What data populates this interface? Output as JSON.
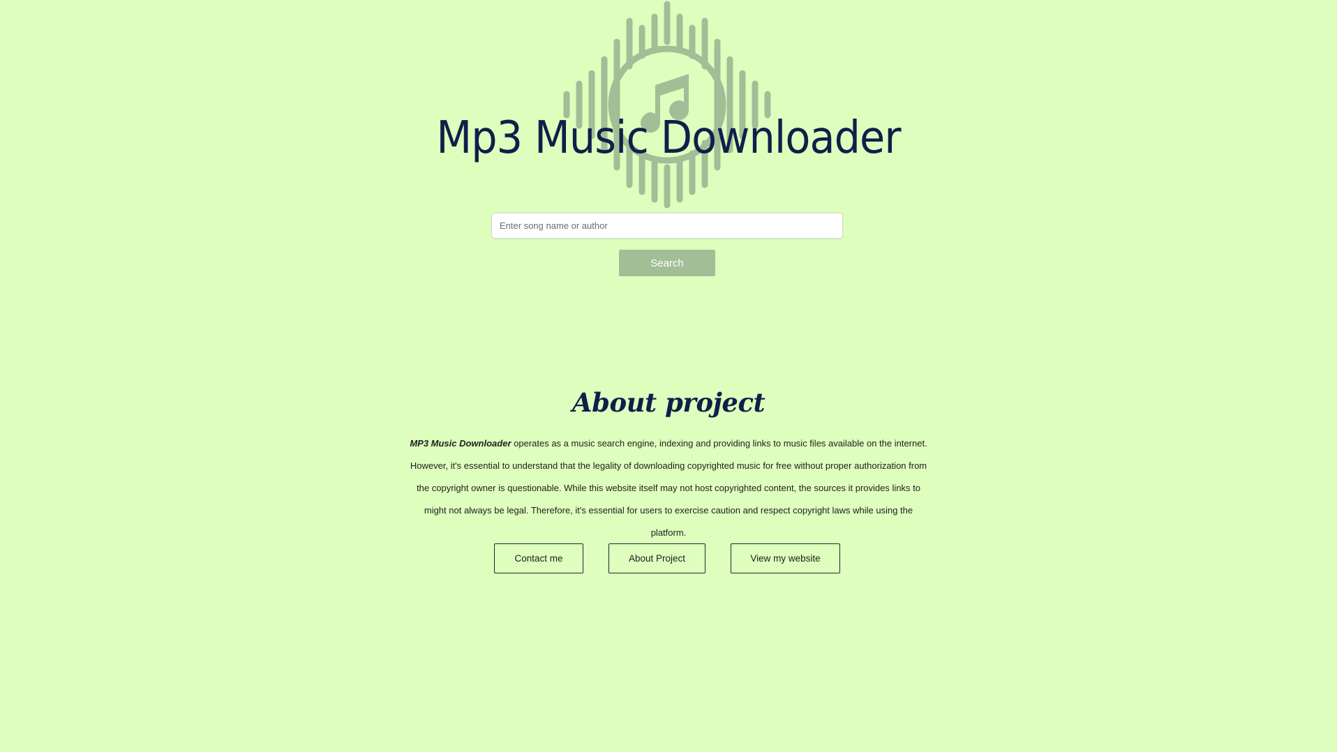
{
  "header": {
    "title": "Mp3 Music Downloader"
  },
  "search": {
    "placeholder": "Enter song name or author",
    "value": "",
    "button_label": "Search"
  },
  "about": {
    "title": "About project",
    "brand": "MP3 Music Downloader",
    "text": " operates as a music search engine, indexing and providing links to music files available on the internet. However, it's essential to understand that the legality of downloading copyrighted music for free without proper authorization from the copyright owner is questionable. While this website itself may not host copyrighted content, the sources it provides links to might not always be legal. Therefore, it's essential for users to exercise caution and respect copyright laws while using the platform."
  },
  "footer_buttons": {
    "contact_label": "Contact me",
    "about_label": "About Project",
    "website_label": "View my website"
  },
  "colors": {
    "background": "#defebd",
    "title": "#0f1f4a",
    "logo": "#a1be97",
    "search_button": "#a1be97"
  },
  "icons": {
    "logo": "music-note-soundwave-icon"
  }
}
